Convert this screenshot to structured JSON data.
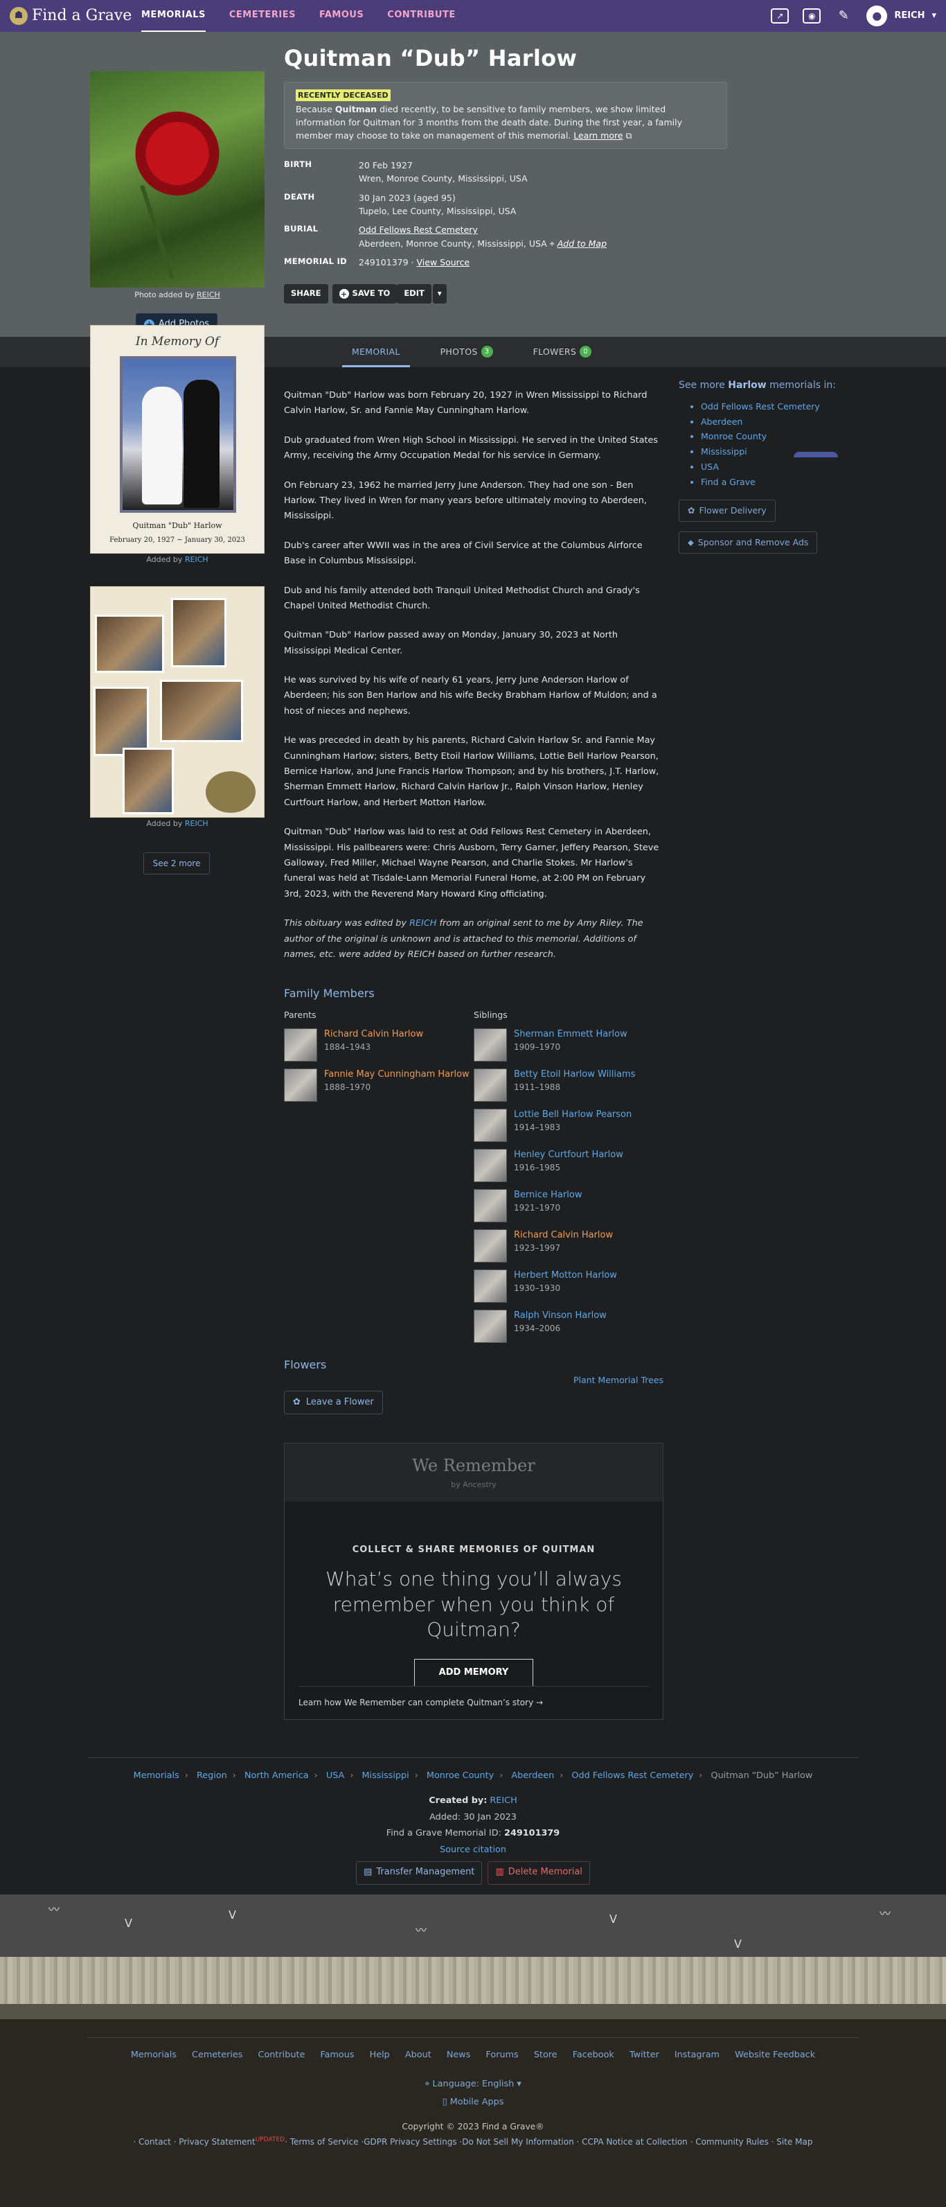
{
  "nav": {
    "logo_text": "Find a Grave",
    "links": [
      "MEMORIALS",
      "CEMETERIES",
      "FAMOUS",
      "CONTRIBUTE"
    ],
    "user": "REICH"
  },
  "memorial": {
    "name": "Quitman “Dub” Harlow",
    "photo_credit_prefix": "Photo added by",
    "photo_credit_user": "REICH",
    "add_photos": "Add Photos",
    "recent_tag": "RECENTLY DECEASED",
    "recent_text_1": "Because",
    "recent_bold": "Quitman",
    "recent_text_2": "died recently, to be sensitive to family members, we show limited information for Quitman for 3 months from the death date. During the first year, a family member may choose to take on management of this memorial.",
    "learn_more": "Learn more",
    "birth_label": "BIRTH",
    "birth_date": "20 Feb 1927",
    "birth_place": "Wren, Monroe County, Mississippi, USA",
    "death_label": "DEATH",
    "death_date": "30 Jan 2023 (aged 95)",
    "death_place": "Tupelo, Lee County, Mississippi, USA",
    "burial_label": "BURIAL",
    "burial_cemetery": "Odd Fellows Rest Cemetery",
    "burial_place": "Aberdeen, Monroe County, Mississippi, USA",
    "add_to_map": "Add to Map",
    "id_label": "MEMORIAL ID",
    "id_value": "249101379 ·",
    "view_source": "View Source",
    "share": "SHARE",
    "save_to": "SAVE TO",
    "edit": "EDIT",
    "more": "▾"
  },
  "tabs": [
    {
      "label": "MEMORIAL",
      "count": ""
    },
    {
      "label": "PHOTOS",
      "count": "3"
    },
    {
      "label": "FLOWERS",
      "count": "0"
    }
  ],
  "side_photos": {
    "photo2_title": "In Memory Of",
    "photo2_caption": "Quitman \"Dub\" Harlow",
    "photo2_dates": "February 20, 1927 ~ January 30, 2023",
    "added_by": "Added by",
    "added_user": "REICH",
    "see_more": "See 2 more"
  },
  "bio": [
    "Quitman \"Dub\" Harlow was born February 20, 1927 in Wren Mississippi to Richard Calvin Harlow, Sr. and Fannie May Cunningham Harlow.",
    "Dub graduated from Wren High School in Mississippi. He served in the United States Army, receiving the Army Occupation Medal for his service in Germany.",
    "On February 23, 1962 he married Jerry June Anderson. They had one son - Ben Harlow. They lived in Wren for many years before ultimately moving to Aberdeen, Mississippi.",
    "Dub's career after WWII was in the area of Civil Service at the Columbus Airforce Base in Columbus Mississippi.",
    "Dub and his family attended both Tranquil United Methodist Church and Grady's Chapel United Methodist Church.",
    "Quitman \"Dub\" Harlow passed away on Monday, January 30, 2023 at North Mississippi Medical Center.",
    "He was survived by his wife of nearly 61 years, Jerry June Anderson Harlow of Aberdeen; his son Ben Harlow and his wife Becky Brabham Harlow of Muldon; and a host of nieces and nephews.",
    "He was preceded in death by his parents, Richard Calvin Harlow Sr. and Fannie May Cunningham Harlow; sisters, Betty Etoil Harlow Williams, Lottie Bell Harlow Pearson, Bernice Harlow, and June Francis Harlow Thompson; and by his brothers, J.T. Harlow, Sherman Emmett Harlow, Richard Calvin Harlow Jr., Ralph Vinson Harlow, Henley Curtfourt Harlow, and Herbert Motton Harlow.",
    "Quitman \"Dub\" Harlow was laid to rest at Odd Fellows Rest Cemetery in Aberdeen, Mississippi. His pallbearers were: Chris Ausborn, Terry Garner, Jeffery Pearson, Steve Galloway, Fred Miller, Michael Wayne Pearson, and Charlie Stokes. Mr Harlow's funeral was held at Tisdale-Lann Memorial Funeral Home, at 2:00 PM on February 3rd, 2023, with the Reverend Mary Howard King officiating."
  ],
  "bio_note": {
    "pre": "This obituary was edited by",
    "user": "REICH",
    "post": "from an original sent to me by Amy Riley. The author of the original is unknown and is attached to this memorial. Additions of names, etc. were added by REICH based on further research."
  },
  "aside": {
    "title_pre": "See more",
    "title_bold": "Harlow",
    "title_post": "memorials in:",
    "links": [
      "Odd Fellows Rest Cemetery",
      "Aberdeen",
      "Monroe County",
      "Mississippi",
      "USA",
      "Find a Grave"
    ],
    "flower_delivery": "Flower Delivery",
    "sponsor": "Sponsor and Remove Ads"
  },
  "family": {
    "title": "Family Members",
    "parents_label": "Parents",
    "siblings_label": "Siblings",
    "parents": [
      {
        "name": "Richard Calvin Harlow",
        "years": "1884–1943",
        "orange": true
      },
      {
        "name": "Fannie May Cunningham Harlow",
        "years": "1888–1970",
        "orange": true
      }
    ],
    "siblings": [
      {
        "name": "Sherman Emmett Harlow",
        "years": "1909–1970",
        "orange": false
      },
      {
        "name": "Betty Etoil Harlow Williams",
        "years": "1911–1988",
        "orange": false
      },
      {
        "name": "Lottie Bell Harlow Pearson",
        "years": "1914–1983",
        "orange": false
      },
      {
        "name": "Henley Curtfourt Harlow",
        "years": "1916–1985",
        "orange": false
      },
      {
        "name": "Bernice Harlow",
        "years": "1921–1970",
        "orange": false
      },
      {
        "name": "Richard Calvin Harlow",
        "years": "1923–1997",
        "orange": true
      },
      {
        "name": "Herbert Motton Harlow",
        "years": "1930–1930",
        "orange": false
      },
      {
        "name": "Ralph Vinson Harlow",
        "years": "1934–2006",
        "orange": false
      }
    ]
  },
  "flowers": {
    "title": "Flowers",
    "plant_trees": "Plant Memorial Trees",
    "leave_flower": "Leave a Flower"
  },
  "we_remember": {
    "logo": "We Remember",
    "logo_sub": "by Ancestry",
    "subtitle": "COLLECT & SHARE MEMORIES OF QUITMAN",
    "question": "What’s one thing you’ll always remember when you think of Quitman?",
    "button": "ADD MEMORY",
    "footer": "Learn how We Remember can complete Quitman’s story →"
  },
  "breadcrumb": [
    "Memorials",
    "Region",
    "North America",
    "USA",
    "Mississippi",
    "Monroe County",
    "Aberdeen",
    "Odd Fellows Rest Cemetery",
    "Quitman “Dub” Harlow"
  ],
  "meta": {
    "created_label": "Created by:",
    "created_user": "REICH",
    "added": "Added: 30 Jan 2023",
    "id_label": "Find a Grave Memorial ID:",
    "id_value": "249101379",
    "citation": "Source citation",
    "transfer": "Transfer Management",
    "delete": "Delete Memorial"
  },
  "footer": {
    "links": [
      "Memorials",
      "Cemeteries",
      "Contribute",
      "Famous",
      "Help",
      "About",
      "News",
      "Forums",
      "Store",
      "Facebook",
      "Twitter",
      "Instagram",
      "Website Feedback"
    ],
    "language": "Language: English",
    "mobile": "Mobile Apps",
    "copyright": "Copyright © 2023 Find a Grave®",
    "legal": "· Contact · Privacy Statement",
    "updated": "UPDATED",
    "legal_2": "· Terms of Service ·GDPR Privacy Settings ·Do Not Sell My Information · CCPA Notice at Collection · Community Rules · Site Map"
  }
}
